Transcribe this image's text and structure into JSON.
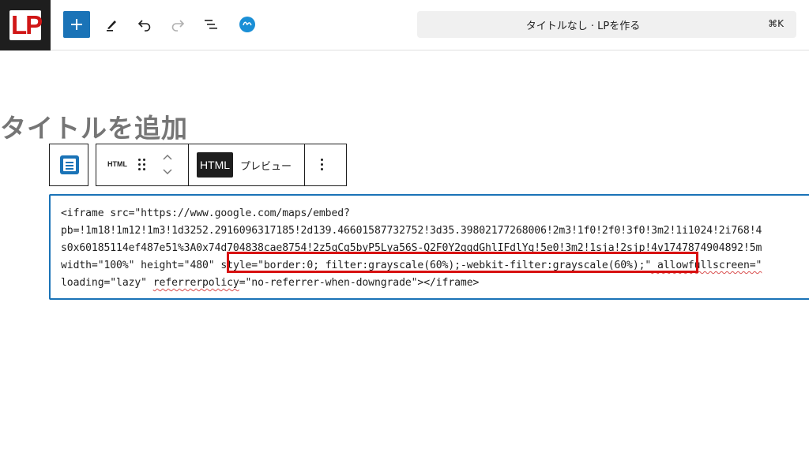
{
  "header": {
    "logo_text": "LP",
    "document_title": "タイトルなし · LPを作る",
    "shortcut": "⌘K"
  },
  "toolbar_icons": [
    "plus-icon",
    "pencil-icon",
    "undo-icon",
    "redo-icon",
    "list-view-icon",
    "jetpack-icon"
  ],
  "colors": {
    "accent": "#1a73b7",
    "logo_red": "#d01616",
    "highlight": "#d81010"
  },
  "post": {
    "title_placeholder": "タイトルを追加"
  },
  "block_toolbar": {
    "block_type_label": "HTML",
    "html_tab": "HTML",
    "preview_tab": "プレビュー"
  },
  "code": {
    "line1": "<iframe src=\"https://www.google.com/maps/embed?",
    "line2": "pb=!1m18!1m12!1m3!1d3252.2916096317185!2d139.46601587732752!3d35.39802177268006!2m3!1f0!2f0!3f0!3m2!1i1024!2i768!4",
    "line3": "s0x60185114ef487e51%3A0x74d704838cae8754!2z5qCg5byP5Lya56S-Q2F0Y2ggdGhlIFdlYg!5e0!3m2!1sja!2sjp!4v1747874904892!5m",
    "line4_a": "width=\"100%\" height=\"480\" ",
    "line4_b": "style=\"border:0; filter:grayscale(60%);-webkit-filter:grayscale(60%);\"",
    "line4_c": " allowfullscreen=\"",
    "line5_a": "loading=\"lazy\" ",
    "line5_b": "referrerpolicy",
    "line5_c": "=\"no-referrer-when-downgrade\"></iframe>"
  }
}
